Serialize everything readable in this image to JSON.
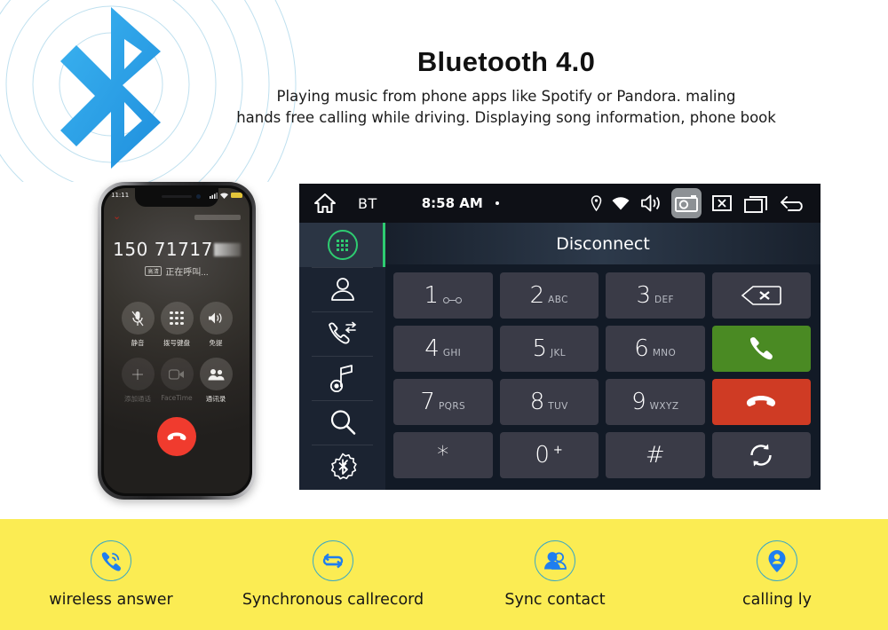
{
  "header": {
    "title": "Bluetooth 4.0",
    "desc_line1": "Playing music from phone apps like Spotify or Pandora. maling",
    "desc_line2": "hands free calling while driving. Displaying  song information, phone book",
    "logo_icon": "bluetooth-logo"
  },
  "phone": {
    "status_time": "11:11",
    "number": "150 71717",
    "call_state": "正在呼叫...",
    "hd_badge": "高清",
    "buttons": [
      {
        "label": "静音",
        "icon": "mute-icon",
        "dim": false
      },
      {
        "label": "拨号键盘",
        "icon": "dialpad-icon",
        "dim": false
      },
      {
        "label": "免提",
        "icon": "speaker-icon",
        "dim": false
      },
      {
        "label": "添加通话",
        "icon": "add-call-icon",
        "dim": true
      },
      {
        "label": "FaceTime",
        "icon": "facetime-icon",
        "dim": true
      },
      {
        "label": "通讯录",
        "icon": "contacts-icon",
        "dim": false
      }
    ],
    "end_call_icon": "end-call-icon"
  },
  "head_unit": {
    "topbar": {
      "home_icon": "home-icon",
      "source_label": "BT",
      "clock": "8:58 AM",
      "dot_indicator": "•",
      "icons": [
        {
          "name": "location-pin-icon",
          "highlight": false
        },
        {
          "name": "wifi-icon",
          "highlight": false
        },
        {
          "name": "volume-icon",
          "highlight": false
        },
        {
          "name": "camera-icon",
          "highlight": true
        },
        {
          "name": "close-box-icon",
          "highlight": false
        },
        {
          "name": "recents-icon",
          "highlight": false
        },
        {
          "name": "back-icon",
          "highlight": false
        }
      ]
    },
    "sidebar": [
      {
        "name": "dialpad",
        "icon": "dialpad-icon",
        "active": true
      },
      {
        "name": "contacts",
        "icon": "contact-person-icon",
        "active": false
      },
      {
        "name": "call-history",
        "icon": "call-history-icon",
        "active": false
      },
      {
        "name": "music",
        "icon": "music-note-icon",
        "active": false
      },
      {
        "name": "search",
        "icon": "search-icon",
        "active": false
      },
      {
        "name": "bluetooth-settings",
        "icon": "bluetooth-gear-icon",
        "active": false
      }
    ],
    "title": "Disconnect",
    "keys": [
      {
        "digit": "1",
        "letters": "",
        "type": "voicemail"
      },
      {
        "digit": "2",
        "letters": "ABC",
        "type": "digit"
      },
      {
        "digit": "3",
        "letters": "DEF",
        "type": "digit"
      },
      {
        "digit": "",
        "letters": "",
        "type": "backspace",
        "icon": "backspace-icon"
      },
      {
        "digit": "4",
        "letters": "GHI",
        "type": "digit"
      },
      {
        "digit": "5",
        "letters": "JKL",
        "type": "digit"
      },
      {
        "digit": "6",
        "letters": "MNO",
        "type": "digit"
      },
      {
        "digit": "",
        "letters": "",
        "type": "call",
        "icon": "call-icon"
      },
      {
        "digit": "7",
        "letters": "PQRS",
        "type": "digit"
      },
      {
        "digit": "8",
        "letters": "TUV",
        "type": "digit"
      },
      {
        "digit": "9",
        "letters": "WXYZ",
        "type": "digit"
      },
      {
        "digit": "",
        "letters": "",
        "type": "endcall",
        "icon": "end-call-icon"
      },
      {
        "digit": "*",
        "letters": "",
        "type": "digit"
      },
      {
        "digit": "0",
        "letters": "+",
        "type": "sup"
      },
      {
        "digit": "#",
        "letters": "",
        "type": "digit"
      },
      {
        "digit": "",
        "letters": "",
        "type": "sync",
        "icon": "sync-icon"
      }
    ]
  },
  "footer": {
    "items": [
      {
        "label": "wireless answer",
        "icon": "wireless-call-icon"
      },
      {
        "label": "Synchronous callrecord",
        "icon": "sync-loop-icon"
      },
      {
        "label": "Sync contact",
        "icon": "contacts-pair-icon"
      },
      {
        "label": "calling ly",
        "icon": "caller-id-icon"
      }
    ]
  },
  "colors": {
    "bluetooth_blue": "#29a0e8",
    "footer_yellow": "#fbec53",
    "accent_green": "#4a8a23",
    "accent_red": "#cf3b24",
    "sidebar_active_green": "#2ecc71",
    "footer_icon_blue": "#1e7ef0"
  }
}
